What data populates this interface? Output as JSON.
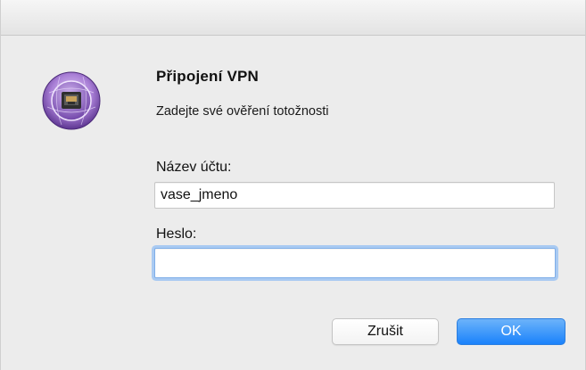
{
  "dialog": {
    "title": "Připojení VPN",
    "subtitle": "Zadejte své ověření totožnosti"
  },
  "app_icon": {
    "name": "network-vpn-icon",
    "colors": [
      "#7b4fb0",
      "#c9a6e8",
      "#3a3a3a"
    ]
  },
  "form": {
    "account_label": "Název účtu:",
    "account_value": "vase_jmeno",
    "password_label": "Heslo:",
    "password_value": ""
  },
  "buttons": {
    "cancel_label": "Zrušit",
    "ok_label": "OK"
  },
  "colors": {
    "accent": "#1a82fb",
    "focus_ring": "#a9caf2",
    "background": "#ececec"
  }
}
